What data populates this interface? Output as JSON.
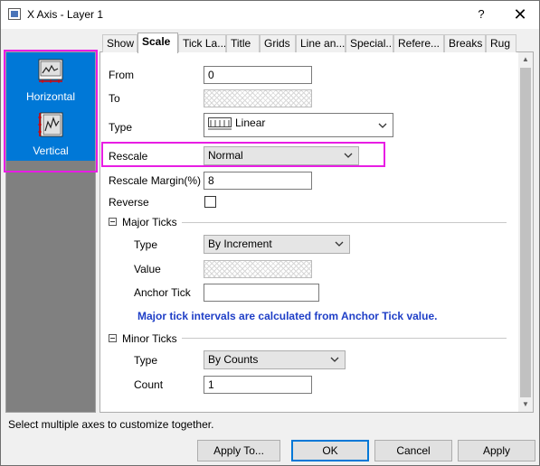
{
  "window": {
    "title": "X Axis - Layer 1",
    "help_label": "?",
    "close_label": "✕"
  },
  "axes_list": [
    {
      "label": "Horizontal",
      "icon": "horizontal-axis-icon"
    },
    {
      "label": "Vertical",
      "icon": "vertical-axis-icon"
    }
  ],
  "tabs": [
    "Show",
    "Scale",
    "Tick La...",
    "Title",
    "Grids",
    "Line an...",
    "Special...",
    "Refere...",
    "Breaks",
    "Rug"
  ],
  "active_tab": "Scale",
  "scale": {
    "from_label": "From",
    "from_value": "0",
    "to_label": "To",
    "to_value": "",
    "type_label": "Type",
    "type_value": "Linear",
    "rescale_label": "Rescale",
    "rescale_value": "Normal",
    "rescale_margin_label": "Rescale Margin(%)",
    "rescale_margin_value": "8",
    "reverse_label": "Reverse",
    "reverse_checked": false
  },
  "major_ticks": {
    "header": "Major Ticks",
    "type_label": "Type",
    "type_value": "By Increment",
    "value_label": "Value",
    "value_value": "",
    "anchor_label": "Anchor Tick",
    "anchor_value": "",
    "info_text": "Major tick intervals are calculated from Anchor Tick value."
  },
  "minor_ticks": {
    "header": "Minor Ticks",
    "type_label": "Type",
    "type_value": "By Counts",
    "count_label": "Count",
    "count_value": "1"
  },
  "status_text": "Select multiple axes to customize together.",
  "buttons": {
    "apply_to": "Apply To...",
    "ok": "OK",
    "cancel": "Cancel",
    "apply": "Apply"
  },
  "colors": {
    "selection": "#0078d7",
    "highlight": "#e81de4",
    "info_text": "#1f3fc7"
  }
}
